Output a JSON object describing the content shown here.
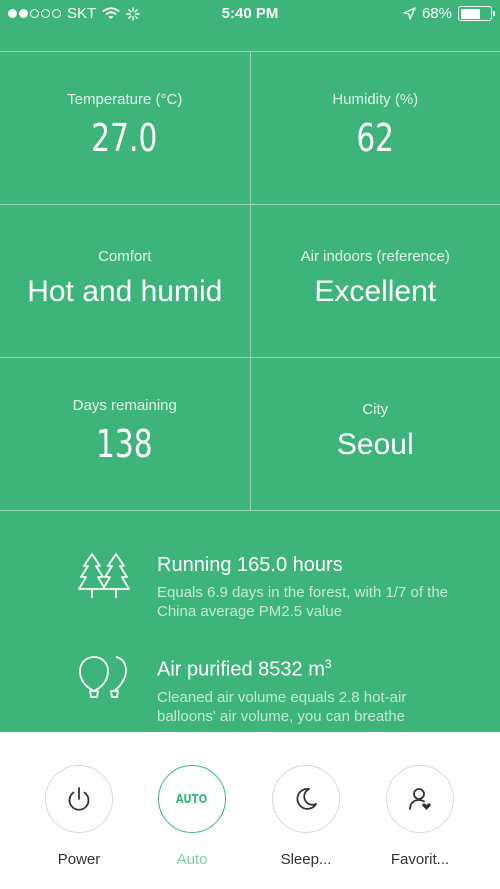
{
  "status_bar": {
    "carrier": "SKT",
    "time": "5:40 PM",
    "battery_percent": "68%",
    "battery_level": 0.68
  },
  "metrics": {
    "temperature": {
      "label": "Temperature (°C)",
      "value": "27.0"
    },
    "humidity": {
      "label": "Humidity (%)",
      "value": "62"
    },
    "comfort": {
      "label": "Comfort",
      "value": "Hot and humid"
    },
    "air_indoors": {
      "label": "Air indoors (reference)",
      "value": "Excellent"
    },
    "days_remaining": {
      "label": "Days remaining",
      "value": "138"
    },
    "city": {
      "label": "City",
      "value": "Seoul"
    }
  },
  "info": {
    "running": {
      "title": "Running 165.0 hours",
      "desc": "Equals 6.9 days in the forest, with 1/7 of the China average PM2.5 value",
      "icon": "trees-icon"
    },
    "air_purified": {
      "title": "Air purified 8532 m",
      "title_sup": "3",
      "desc": "Cleaned air volume equals 2.8 hot-air balloons' air volume, you can breathe",
      "icon": "balloons-icon"
    }
  },
  "bottom_bar": {
    "power": {
      "label": "Power",
      "icon": "power-icon"
    },
    "auto": {
      "label": "Auto",
      "icon_text": "AUTO"
    },
    "sleep": {
      "label": "Sleep...",
      "icon": "moon-icon"
    },
    "favorite": {
      "label": "Favorit...",
      "icon": "user-heart-icon"
    }
  },
  "colors": {
    "brand_green": "#3db57a",
    "active_label": "#7fd2a8"
  }
}
